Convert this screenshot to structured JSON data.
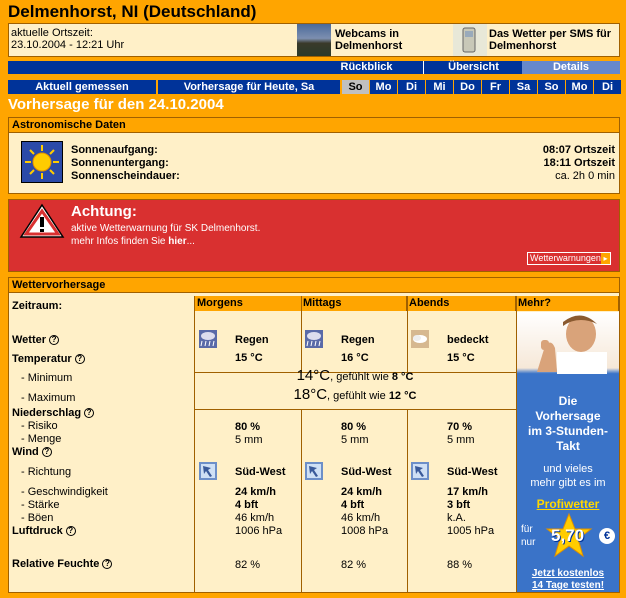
{
  "header": {
    "title": "Delmenhorst, NI (Deutschland)",
    "localtime_label": "aktuelle Ortszeit:",
    "localtime_value": "23.10.2004 - 12:21 Uhr",
    "webcams_label_1": "Webcams in",
    "webcams_label_2": "Delmenhorst",
    "sms_label_1": "Das Wetter per SMS für",
    "sms_label_2": "Delmenhorst"
  },
  "nav": {
    "back": "Rückblick",
    "overview": "Übersicht",
    "details": "Details"
  },
  "daybar": {
    "current": "Aktuell gemessen",
    "forecast_today": "Vorhersage für Heute, Sa",
    "days": [
      "So",
      "Mo",
      "Di",
      "Mi",
      "Do",
      "Fr",
      "Sa",
      "So",
      "Mo",
      "Di"
    ],
    "active_day_index": 0
  },
  "forecast_heading": "Vorhersage für den 24.10.2004",
  "astro": {
    "heading": "Astronomische Daten",
    "sunrise_label": "Sonnenaufgang:",
    "sunrise_value": "08:07 Ortszeit",
    "sunset_label": "Sonnenuntergang:",
    "sunset_value": "18:11 Ortszeit",
    "duration_label": "Sonnenscheindauer:",
    "duration_value": "ca. 2h 0 min"
  },
  "alert": {
    "title": "Achtung:",
    "line1": "aktive Wetterwarnung für SK Delmenhorst.",
    "line2_prefix": "mehr Infos finden Sie ",
    "line2_link": "hier",
    "line2_suffix": "...",
    "button": "Wetterwarnungen"
  },
  "forecast": {
    "heading": "Wettervorhersage",
    "period_label": "Zeitraum:",
    "columns": [
      "Morgens",
      "Mittags",
      "Abends",
      "Mehr?"
    ],
    "rows": {
      "weather_label": "Wetter",
      "temp_label": "Temperatur",
      "min_label": "- Minimum",
      "max_label": "- Maximum",
      "precip_label": "Niederschlag",
      "risk_label": "- Risiko",
      "amount_label": "- Menge",
      "wind_label": "Wind",
      "direction_label": "- Richtung",
      "speed_label": "- Geschwindigkeit",
      "strength_label": "- Stärke",
      "gusts_label": "- Böen",
      "pressure_label": "Luftdruck",
      "humidity_label": "Relative Feuchte"
    },
    "periods": [
      {
        "weather": "Regen",
        "temp": "15 °C",
        "risk": "80 %",
        "amount": "5 mm",
        "direction": "Süd-West",
        "speed": "24 km/h",
        "strength": "4 bft",
        "gusts": "46 km/h",
        "pressure": "1006 hPa",
        "humidity": "82 %"
      },
      {
        "weather": "Regen",
        "temp": "16 °C",
        "risk": "80 %",
        "amount": "5 mm",
        "direction": "Süd-West",
        "speed": "24 km/h",
        "strength": "4 bft",
        "gusts": "46 km/h",
        "pressure": "1008 hPa",
        "humidity": "82 %"
      },
      {
        "weather": "bedeckt",
        "temp": "15 °C",
        "risk": "70 %",
        "amount": "5 mm",
        "direction": "Süd-West",
        "speed": "17 km/h",
        "strength": "3 bft",
        "gusts": "k.A.",
        "pressure": "1005 hPa",
        "humidity": "88 %"
      }
    ],
    "min_temp": "14°C",
    "min_feels": ", gefühlt wie ",
    "min_feels_value": "8 °C",
    "max_temp": "18°C",
    "max_feels": ", gefühlt wie ",
    "max_feels_value": "12 °C"
  },
  "ad": {
    "line1": "Die",
    "line2": "Vorhersage",
    "line3": "im 3-Stunden-",
    "line4": "Takt",
    "line5": "und vieles",
    "line6": "mehr gibt es im",
    "brand": "Profiwetter",
    "for_label": "für",
    "only_label": "nur",
    "price": "5,70",
    "currency": "€",
    "cta1": "Jetzt kostenlos",
    "cta2": "14 Tage testen!"
  }
}
